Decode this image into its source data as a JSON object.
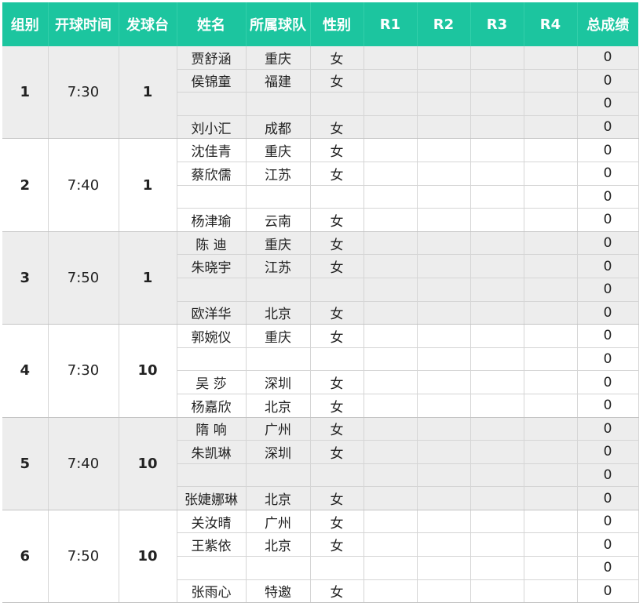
{
  "header": {
    "group": "组别",
    "tee_time": "开球时间",
    "tee": "发球台",
    "name": "姓名",
    "team": "所属球队",
    "sex": "性别",
    "r1": "R1",
    "r2": "R2",
    "r3": "R3",
    "r4": "R4",
    "total": "总成绩"
  },
  "colors": {
    "header_bg": "#1cc59f",
    "header_text": "#ffffff",
    "band_grey": "#ededed",
    "band_white": "#ffffff"
  },
  "groups": [
    {
      "group": "1",
      "time": "7:30",
      "tee": "1",
      "players": [
        {
          "name": "贾舒涵",
          "team": "重庆",
          "sex": "女",
          "total": "0"
        },
        {
          "name": "侯锦童",
          "team": "福建",
          "sex": "女",
          "total": "0"
        },
        {
          "name": "",
          "team": "",
          "sex": "",
          "total": "0"
        },
        {
          "name": "刘小汇",
          "team": "成都",
          "sex": "女",
          "total": "0"
        }
      ]
    },
    {
      "group": "2",
      "time": "7:40",
      "tee": "1",
      "players": [
        {
          "name": "沈佳青",
          "team": "重庆",
          "sex": "女",
          "total": "0"
        },
        {
          "name": "蔡欣儒",
          "team": "江苏",
          "sex": "女",
          "total": "0"
        },
        {
          "name": "",
          "team": "",
          "sex": "",
          "total": "0"
        },
        {
          "name": "杨津瑜",
          "team": "云南",
          "sex": "女",
          "total": "0"
        }
      ]
    },
    {
      "group": "3",
      "time": "7:50",
      "tee": "1",
      "players": [
        {
          "name": "陈 迪",
          "team": "重庆",
          "sex": "女",
          "total": "0"
        },
        {
          "name": "朱晓宇",
          "team": "江苏",
          "sex": "女",
          "total": "0"
        },
        {
          "name": "",
          "team": "",
          "sex": "",
          "total": "0"
        },
        {
          "name": "欧洋华",
          "team": "北京",
          "sex": "女",
          "total": "0"
        }
      ]
    },
    {
      "group": "4",
      "time": "7:30",
      "tee": "10",
      "players": [
        {
          "name": "郭婉仪",
          "team": "重庆",
          "sex": "女",
          "total": "0"
        },
        {
          "name": "",
          "team": "",
          "sex": "",
          "total": "0"
        },
        {
          "name": "吴 莎",
          "team": "深圳",
          "sex": "女",
          "total": "0"
        },
        {
          "name": "杨嘉欣",
          "team": "北京",
          "sex": "女",
          "total": "0"
        }
      ]
    },
    {
      "group": "5",
      "time": "7:40",
      "tee": "10",
      "players": [
        {
          "name": "隋 响",
          "team": "广州",
          "sex": "女",
          "total": "0"
        },
        {
          "name": "朱凯琳",
          "team": "深圳",
          "sex": "女",
          "total": "0"
        },
        {
          "name": "",
          "team": "",
          "sex": "",
          "total": "0"
        },
        {
          "name": "张婕娜琳",
          "team": "北京",
          "sex": "女",
          "total": "0"
        }
      ]
    },
    {
      "group": "6",
      "time": "7:50",
      "tee": "10",
      "players": [
        {
          "name": "关汝晴",
          "team": "广州",
          "sex": "女",
          "total": "0"
        },
        {
          "name": "王紫依",
          "team": "北京",
          "sex": "女",
          "total": "0"
        },
        {
          "name": "",
          "team": "",
          "sex": "",
          "total": "0"
        },
        {
          "name": "张雨心",
          "team": "特邀",
          "sex": "女",
          "total": "0"
        }
      ]
    }
  ]
}
